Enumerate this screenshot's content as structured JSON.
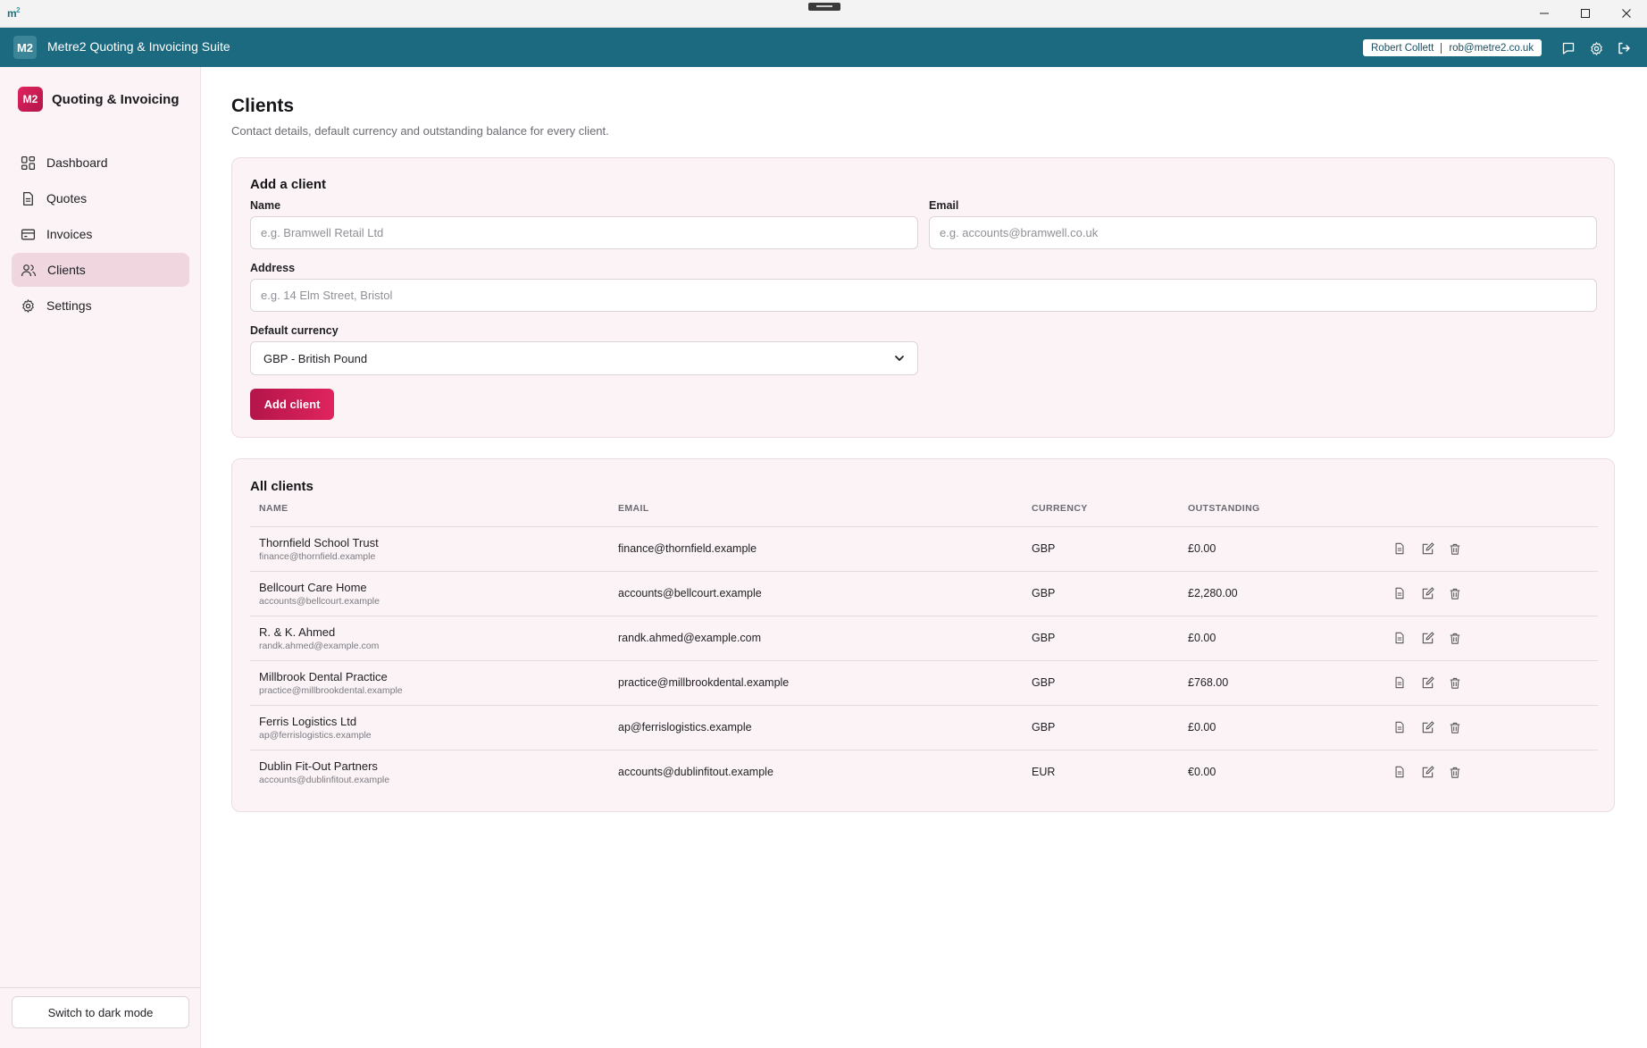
{
  "os": {
    "logo": "m",
    "logo_sup": "2"
  },
  "header": {
    "badge": "M2",
    "title": "Metre2 Quoting & Invoicing Suite",
    "user_name": "Robert Collett",
    "user_email": "rob@metre2.co.uk",
    "icons": [
      "chat-icon",
      "gear-icon",
      "logout-icon"
    ]
  },
  "sidebar": {
    "brand_badge": "M2",
    "brand_name": "Quoting & Invoicing",
    "items": [
      {
        "label": "Dashboard",
        "icon": "dashboard-icon"
      },
      {
        "label": "Quotes",
        "icon": "document-icon"
      },
      {
        "label": "Invoices",
        "icon": "card-icon"
      },
      {
        "label": "Clients",
        "icon": "users-icon",
        "active": true
      },
      {
        "label": "Settings",
        "icon": "gear-icon"
      }
    ],
    "dark_mode_label": "Switch to dark mode"
  },
  "page": {
    "title": "Clients",
    "subtitle": "Contact details, default currency and outstanding balance for every client."
  },
  "add_form": {
    "title": "Add a client",
    "name_label": "Name",
    "name_placeholder": "e.g. Bramwell Retail Ltd",
    "email_label": "Email",
    "email_placeholder": "e.g. accounts@bramwell.co.uk",
    "address_label": "Address",
    "address_placeholder": "e.g. 14 Elm Street, Bristol",
    "currency_label": "Default currency",
    "currency_value": "GBP - British Pound",
    "submit_label": "Add client"
  },
  "clients": {
    "title": "All clients",
    "columns": [
      "NAME",
      "EMAIL",
      "CURRENCY",
      "OUTSTANDING"
    ],
    "rows": [
      {
        "name": "Thornfield School Trust",
        "sub": "finance@thornfield.example",
        "email": "finance@thornfield.example",
        "currency": "GBP",
        "outstanding": "£0.00"
      },
      {
        "name": "Bellcourt Care Home",
        "sub": "accounts@bellcourt.example",
        "email": "accounts@bellcourt.example",
        "currency": "GBP",
        "outstanding": "£2,280.00"
      },
      {
        "name": "R. & K. Ahmed",
        "sub": "randk.ahmed@example.com",
        "email": "randk.ahmed@example.com",
        "currency": "GBP",
        "outstanding": "£0.00"
      },
      {
        "name": "Millbrook Dental Practice",
        "sub": "practice@millbrookdental.example",
        "email": "practice@millbrookdental.example",
        "currency": "GBP",
        "outstanding": "£768.00"
      },
      {
        "name": "Ferris Logistics Ltd",
        "sub": "ap@ferrislogistics.example",
        "email": "ap@ferrislogistics.example",
        "currency": "GBP",
        "outstanding": "£0.00"
      },
      {
        "name": "Dublin Fit-Out Partners",
        "sub": "accounts@dublinfitout.example",
        "email": "accounts@dublinfitout.example",
        "currency": "EUR",
        "outstanding": "€0.00"
      }
    ],
    "row_actions": [
      "view-document-icon",
      "edit-icon",
      "trash-icon"
    ]
  },
  "colors": {
    "header": "#1b6a80",
    "accent": "#d81f57",
    "sidebar_bg": "#fbf3f5",
    "active_nav": "#f0d6df"
  }
}
